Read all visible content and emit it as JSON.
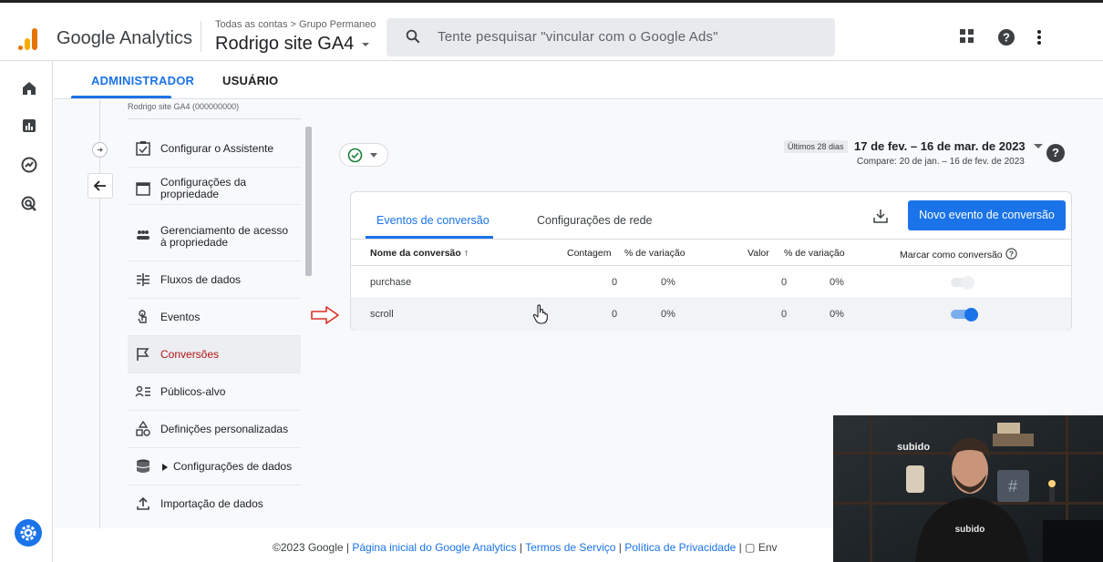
{
  "header": {
    "product": "Google Analytics",
    "breadcrumb": "Todas as contas > Grupo Permaneo",
    "account": "Rodrigo site GA4",
    "search_placeholder": "Tente pesquisar \"vincular com o Google Ads\""
  },
  "admin_tabs": [
    "ADMINISTRADOR",
    "USUÁRIO"
  ],
  "nav": {
    "cut_label": "Rodrigo site GA4 (000000000)",
    "items": [
      {
        "label": "Configurar o Assistente",
        "icon": "assistant-checkbox-icon"
      },
      {
        "label": "Configurações da propriedade",
        "icon": "property-settings-icon"
      },
      {
        "label": "Gerenciamento de acesso à propriedade",
        "icon": "people-icon"
      },
      {
        "label": "Fluxos de dados",
        "icon": "data-streams-icon"
      },
      {
        "label": "Eventos",
        "icon": "events-touch-icon"
      },
      {
        "label": "Conversões",
        "icon": "flag-icon",
        "active": true
      },
      {
        "label": "Públicos-alvo",
        "icon": "audiences-icon"
      },
      {
        "label": "Definições personalizadas",
        "icon": "shapes-icon"
      },
      {
        "label": "Configurações de dados",
        "icon": "database-icon"
      },
      {
        "label": "Importação de dados",
        "icon": "upload-icon"
      }
    ]
  },
  "date": {
    "tag": "Últimos 28 dias",
    "range": "17 de fev. – 16 de mar. de 2023",
    "compare": "Compare: 20 de jan. – 16 de fev. de 2023"
  },
  "card": {
    "tabs": [
      "Eventos de conversão",
      "Configurações de rede"
    ],
    "new_button": "Novo evento de conversão",
    "columns": [
      "Nome da conversão",
      "Contagem",
      "% de variação",
      "Valor",
      "% de variação",
      "Marcar como conversão"
    ],
    "rows": [
      {
        "name": "purchase",
        "count": "0",
        "count_change": "0%",
        "value": "0",
        "value_change": "0%",
        "conversion": false
      },
      {
        "name": "scroll",
        "count": "0",
        "count_change": "0%",
        "value": "0",
        "value_change": "0%",
        "conversion": true
      }
    ]
  },
  "footer": {
    "copyright": "©2023 Google",
    "links": [
      "Página inicial do Google Analytics",
      "Termos de Serviço",
      "Política de Privacidade"
    ],
    "feedback": "Env"
  },
  "video": {
    "wall_text": "subido",
    "shirt_text": "subido"
  },
  "colors": {
    "accent": "#1a73e8",
    "active_nav_text": "#b31412",
    "toggle_on": "#1a73e8",
    "toggle_off": "#dadce0",
    "arrow": "#d93025"
  }
}
